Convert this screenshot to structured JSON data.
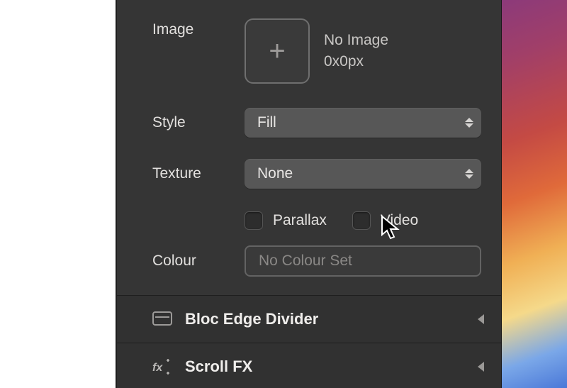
{
  "inspector": {
    "image": {
      "label": "Image",
      "status": "No Image",
      "dimensions": "0x0px",
      "add_glyph": "+"
    },
    "style": {
      "label": "Style",
      "value": "Fill"
    },
    "texture": {
      "label": "Texture",
      "value": "None"
    },
    "checks": {
      "parallax": {
        "label": "Parallax",
        "checked": false
      },
      "video": {
        "label": "Video",
        "checked": false
      }
    },
    "colour": {
      "label": "Colour",
      "placeholder": "No Colour Set"
    }
  },
  "sections": {
    "divider": {
      "title": "Bloc Edge Divider"
    },
    "scrollfx": {
      "title": "Scroll FX"
    }
  }
}
